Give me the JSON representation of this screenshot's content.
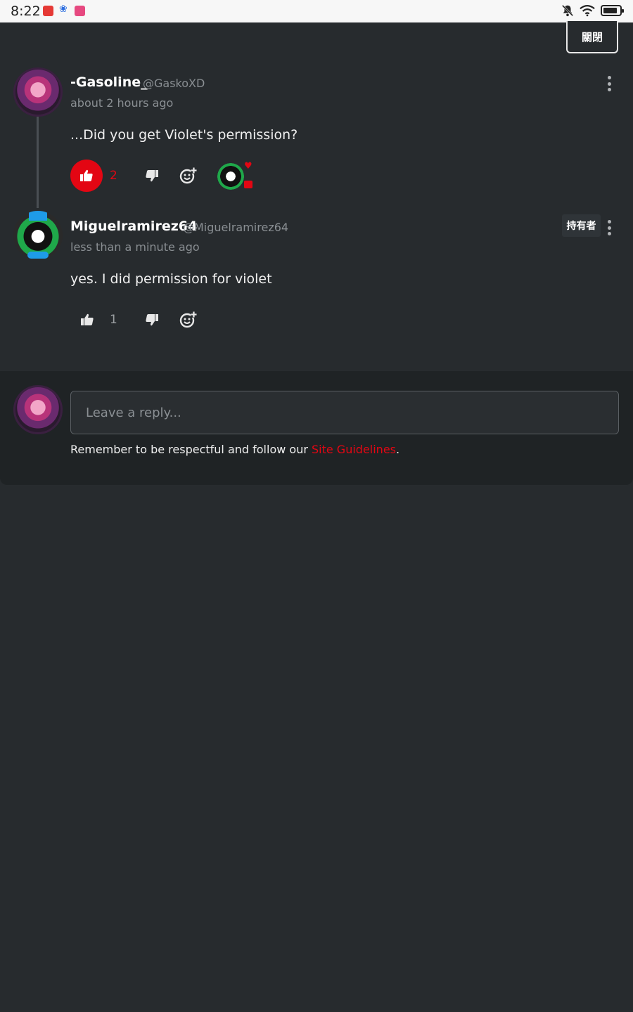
{
  "status_bar": {
    "time": "8:22",
    "icons": [
      "app-red-icon",
      "app-blue-flower-icon",
      "app-pink-icon",
      "notifications-off-icon",
      "wifi-icon",
      "battery-icon"
    ],
    "battery_level": 0.85
  },
  "close_button": {
    "label": "關閉"
  },
  "comments": [
    {
      "username": "-Gasoline_",
      "handle": "@GaskoXD",
      "time": "about 2 hours ago",
      "text": "...Did you get Violet's permission?",
      "likes": "2",
      "liked": true,
      "reactions": [
        "mickey-avatar-reaction",
        "heart-icon"
      ]
    },
    {
      "username": "Miguelramirez64",
      "handle": "@Miguelramirez64",
      "badge": "持有者",
      "time": "less than a minute ago",
      "text": "yes. I did permission for violet",
      "likes": "1",
      "liked": false
    }
  ],
  "reply": {
    "placeholder": "Leave a reply...",
    "guidelines_prefix": "Remember to be respectful and follow our ",
    "guidelines_link": "Site Guidelines",
    "guidelines_suffix": "."
  },
  "colors": {
    "accent": "#e30613",
    "background": "#272b2e",
    "panel": "#1f2325"
  }
}
